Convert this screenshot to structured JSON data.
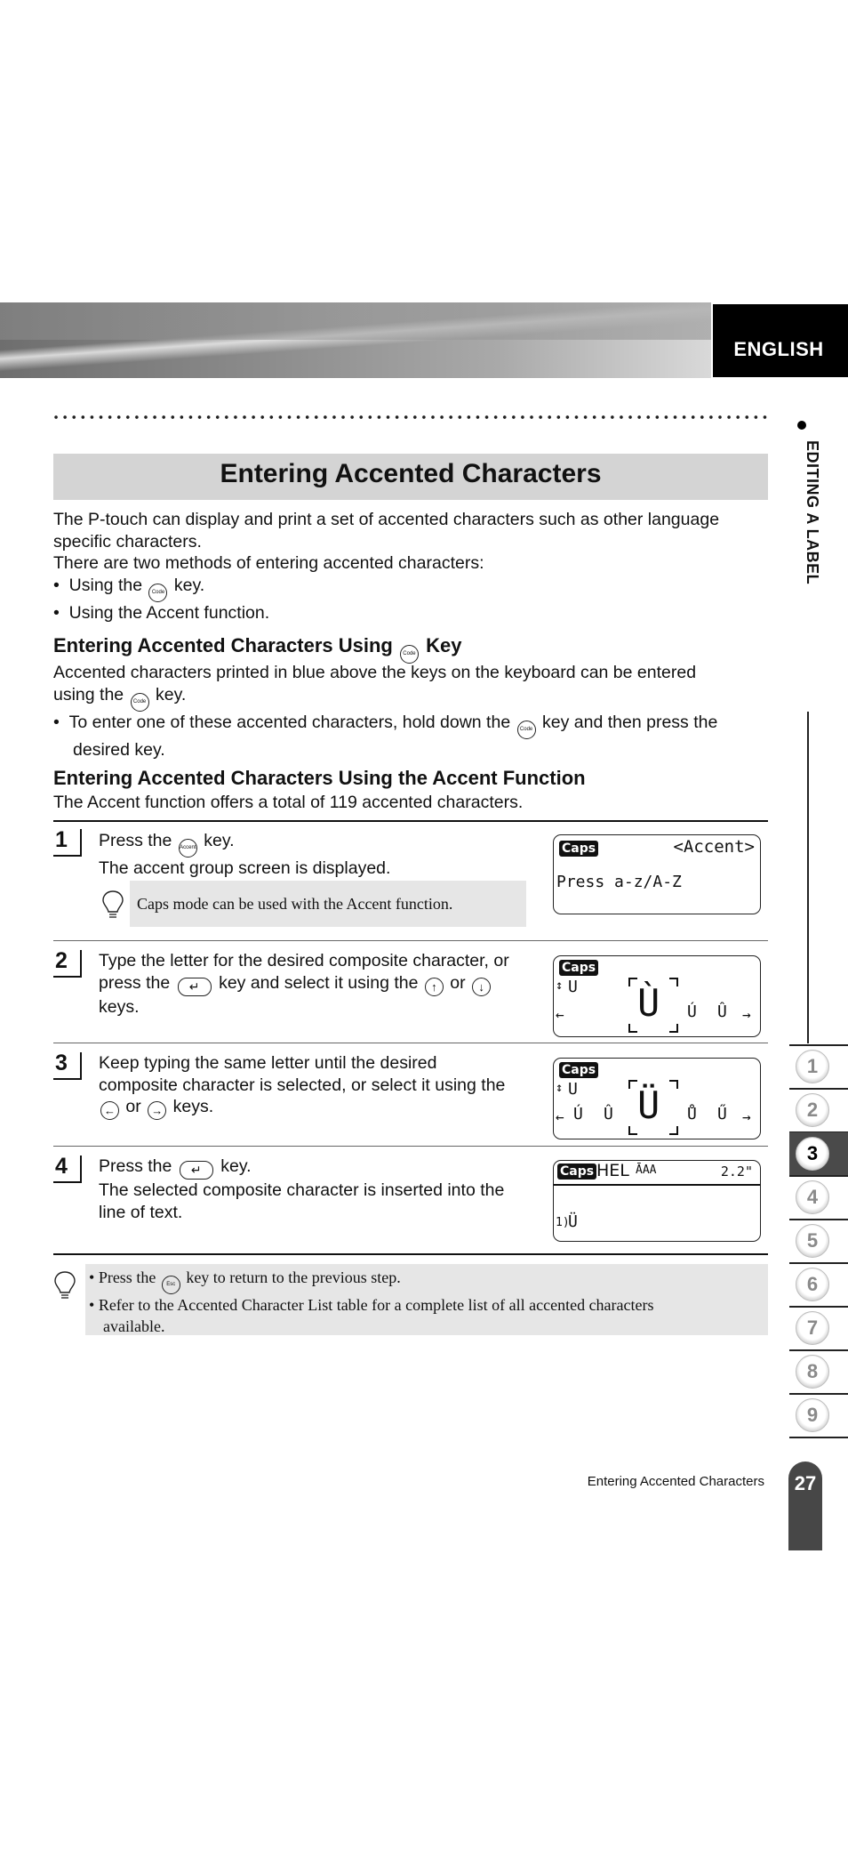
{
  "header": {
    "language": "ENGLISH"
  },
  "side": {
    "section_label": "EDITING A LABEL"
  },
  "title": "Entering Accented Characters",
  "intro": {
    "line1": "The P-touch can display and print a set of accented characters such as other language",
    "line2": "specific characters.",
    "line3": "There are two methods of entering accented characters:",
    "bullets": [
      {
        "pre": "Using the",
        "key": "Code",
        "post": "key."
      },
      {
        "text": "Using the Accent function."
      }
    ]
  },
  "section1": {
    "heading_pre": "Entering Accented Characters Using",
    "heading_key": "Code",
    "heading_post": "Key",
    "p_line1": "Accented characters printed in blue above the keys on the keyboard can be entered",
    "p_line2_pre": "using the",
    "p_line2_key": "Code",
    "p_line2_post": "key.",
    "bullet_pre": "To enter one of these accented characters, hold down the",
    "bullet_key": "Code",
    "bullet_post": "key and then press the",
    "bullet_line2": "desired key."
  },
  "section2": {
    "heading": "Entering Accented Characters Using the Accent Function",
    "intro": "The Accent function offers a total of 119 accented characters."
  },
  "steps": [
    {
      "num": "1",
      "line1_pre": "Press the",
      "line1_key": "Accent",
      "line1_post": "key.",
      "line2": "The accent group screen is displayed.",
      "tip": "Caps mode can be used with the Accent function.",
      "lcd": {
        "caps": "Caps",
        "mode": "<Accent>",
        "prompt": "Press a-z/A-Z"
      }
    },
    {
      "num": "2",
      "line1": "Type the letter for the desired composite character, or",
      "line2_pre": "press the",
      "line2_key": "↵",
      "line2_mid": "key and select it using the",
      "key_up": "↑",
      "or": "or",
      "key_down": "↓",
      "line3": "keys.",
      "lcd": {
        "caps": "Caps",
        "updown": "↕",
        "base": "U",
        "left": "←",
        "selected": "Ù",
        "next1": "Ú",
        "next2": "Û",
        "right": "→"
      }
    },
    {
      "num": "3",
      "line1": "Keep typing the same letter until the desired",
      "line2": "composite character is selected, or select it using the",
      "key_left": "←",
      "or": "or",
      "key_right": "→",
      "line3_post": "keys.",
      "lcd": {
        "caps": "Caps",
        "updown": "↕",
        "base": "U",
        "left": "←",
        "prev1": "Ú",
        "prev2": "Û",
        "selected": "Ü",
        "next1": "Ů",
        "next2": "Ű",
        "right": "→"
      }
    },
    {
      "num": "4",
      "line1_pre": "Press the",
      "line1_key": "↵",
      "line1_post": "key.",
      "line2": "The selected composite character is inserted into the",
      "line3": "line of text.",
      "lcd": {
        "caps": "Caps",
        "font": "HEL",
        "size_glyph": "ĀAA",
        "length": "2.2\"",
        "text_marker": "1)",
        "text": "Ü"
      }
    }
  ],
  "notes": {
    "bullet1_pre": "Press the",
    "bullet1_key": "Esc",
    "bullet1_post": "key to return to the previous step.",
    "bullet2_line1": "Refer to the Accented Character List table for a complete list of all accented characters",
    "bullet2_line2": "available."
  },
  "chapters": [
    {
      "label": "1",
      "active": false
    },
    {
      "label": "2",
      "active": false
    },
    {
      "label": "3",
      "active": true
    },
    {
      "label": "4",
      "active": false
    },
    {
      "label": "5",
      "active": false
    },
    {
      "label": "6",
      "active": false
    },
    {
      "label": "7",
      "active": false
    },
    {
      "label": "8",
      "active": false
    },
    {
      "label": "9",
      "active": false
    }
  ],
  "footer": {
    "section": "Entering Accented Characters",
    "page": "27"
  }
}
